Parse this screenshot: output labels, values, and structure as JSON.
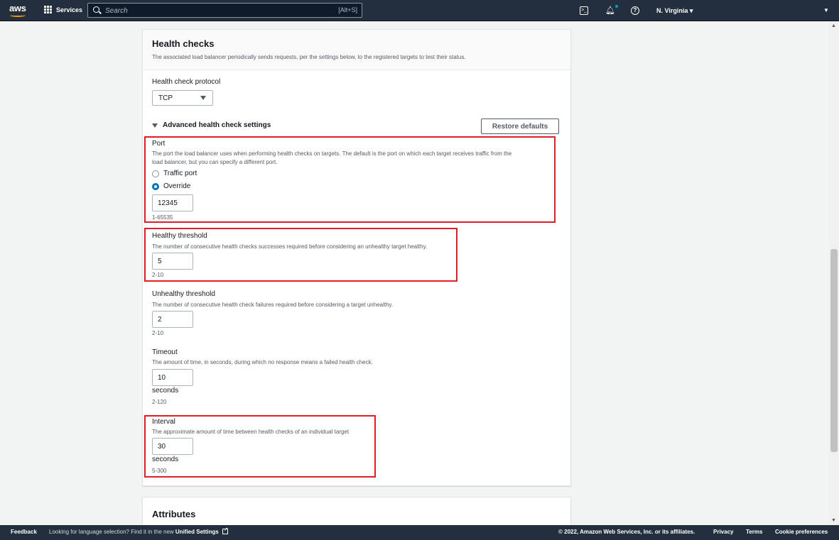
{
  "topnav": {
    "logo": "aws",
    "services_label": "Services",
    "search_placeholder": "Search",
    "search_shortcut": "[Alt+S]",
    "region_label": "N. Virginia ▾",
    "icons": [
      "grid-icon",
      "search-icon",
      "terminal-icon",
      "bell-icon",
      "help-icon",
      "caret-down-icon"
    ]
  },
  "health_checks": {
    "title": "Health checks",
    "description": "The associated load balancer periodically sends requests, per the settings below, to the registered targets to test their status.",
    "protocol_label": "Health check protocol",
    "protocol_value": "TCP",
    "advanced_label": "Advanced health check settings",
    "restore_label": "Restore defaults",
    "port": {
      "label": "Port",
      "description_line1": "The port the load balancer uses when performing health checks on targets. The default is the port on which each target receives traffic from the",
      "description_line2": "load balancer, but you can specify a different port.",
      "option_traffic": "Traffic port",
      "option_override": "Override",
      "selected": "Override",
      "value": "12345",
      "constraint": "1-65535"
    },
    "healthy_threshold": {
      "label": "Healthy threshold",
      "description": "The number of consecutive health checks successes required before considering an unhealthy target healthy.",
      "value": "5",
      "constraint": "2-10"
    },
    "unhealthy_threshold": {
      "label": "Unhealthy threshold",
      "description": "The number of consecutive health check failures required before considering a target unhealthy.",
      "value": "2",
      "constraint": "2-10"
    },
    "timeout": {
      "label": "Timeout",
      "description": "The amount of time, in seconds, during which no response means a failed health check.",
      "value": "10",
      "unit": "seconds",
      "constraint": "2-120"
    },
    "interval": {
      "label": "Interval",
      "description": "The approximate amount of time between health checks of an individual target",
      "value": "30",
      "unit": "seconds",
      "constraint": "5-300"
    }
  },
  "attributes": {
    "title": "Attributes"
  },
  "footer": {
    "feedback": "Feedback",
    "language_text": "Looking for language selection? Find it in the new",
    "unified_settings": "Unified Settings",
    "copyright": "© 2022, Amazon Web Services, Inc. or its affiliates.",
    "privacy": "Privacy",
    "terms": "Terms",
    "cookie": "Cookie preferences"
  },
  "colors": {
    "nav_bg": "#232f3e",
    "highlight": "#e11d26",
    "accent": "#0073bb"
  }
}
